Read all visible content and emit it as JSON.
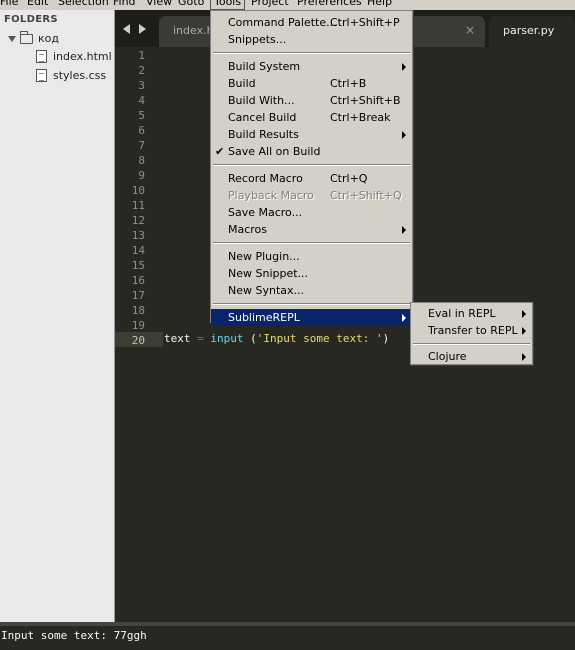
{
  "menubar": {
    "items": [
      "File",
      "Edit",
      "Selection",
      "Find",
      "View",
      "Goto",
      "Tools",
      "Project",
      "Preferences",
      "Help"
    ]
  },
  "sidebar": {
    "header": "FOLDERS",
    "folder": "код",
    "files": [
      "index.html",
      "styles.css"
    ]
  },
  "tabs": {
    "items": [
      {
        "label": "index.h",
        "close": ""
      },
      {
        "label": "",
        "close": "×"
      },
      {
        "label": "parser.py",
        "close": ""
      }
    ]
  },
  "editor": {
    "line_numbers": [
      "1",
      "2",
      "3",
      "4",
      "5",
      "6",
      "7",
      "8",
      "9",
      "10",
      "11",
      "12",
      "13",
      "14",
      "15",
      "16",
      "17",
      "18",
      "19",
      "20"
    ],
    "code": {
      "var": "text",
      "op": "=",
      "fn": "input",
      "open": "(",
      "str": "'Input some text: '",
      "close": ")"
    }
  },
  "tools_menu": {
    "groups": [
      [
        {
          "label": "Command Palette...",
          "shortcut": "Ctrl+Shift+P"
        },
        {
          "label": "Snippets...",
          "shortcut": ""
        }
      ],
      [
        {
          "label": "Build System",
          "shortcut": "",
          "submenu": true
        },
        {
          "label": "Build",
          "shortcut": "Ctrl+B"
        },
        {
          "label": "Build With...",
          "shortcut": "Ctrl+Shift+B"
        },
        {
          "label": "Cancel Build",
          "shortcut": "Ctrl+Break"
        },
        {
          "label": "Build Results",
          "shortcut": "",
          "submenu": true
        },
        {
          "label": "Save All on Build",
          "shortcut": "",
          "checked": true
        }
      ],
      [
        {
          "label": "Record Macro",
          "shortcut": "Ctrl+Q"
        },
        {
          "label": "Playback Macro",
          "shortcut": "Ctrl+Shift+Q",
          "disabled": true
        },
        {
          "label": "Save Macro...",
          "shortcut": ""
        },
        {
          "label": "Macros",
          "shortcut": "",
          "submenu": true
        }
      ],
      [
        {
          "label": "New Plugin...",
          "shortcut": ""
        },
        {
          "label": "New Snippet...",
          "shortcut": ""
        },
        {
          "label": "New Syntax...",
          "shortcut": ""
        }
      ],
      [
        {
          "label": "SublimeREPL",
          "shortcut": "",
          "submenu": true,
          "highlighted": true
        }
      ]
    ]
  },
  "sublimerepl_menu": {
    "items": [
      {
        "label": "Eval in REPL",
        "submenu": true
      },
      {
        "label": "Transfer to REPL",
        "submenu": true
      },
      {
        "label": "Clojure",
        "submenu": true,
        "separator_before": true
      }
    ]
  },
  "console": {
    "text": "Input some text: 77ggh"
  },
  "colors": {
    "editor_bg": "#272822",
    "keyword": "#f92672",
    "function": "#66d9ef",
    "string": "#e6db74",
    "menu_bg": "#d4d0c8",
    "highlight": "#0a246a"
  }
}
